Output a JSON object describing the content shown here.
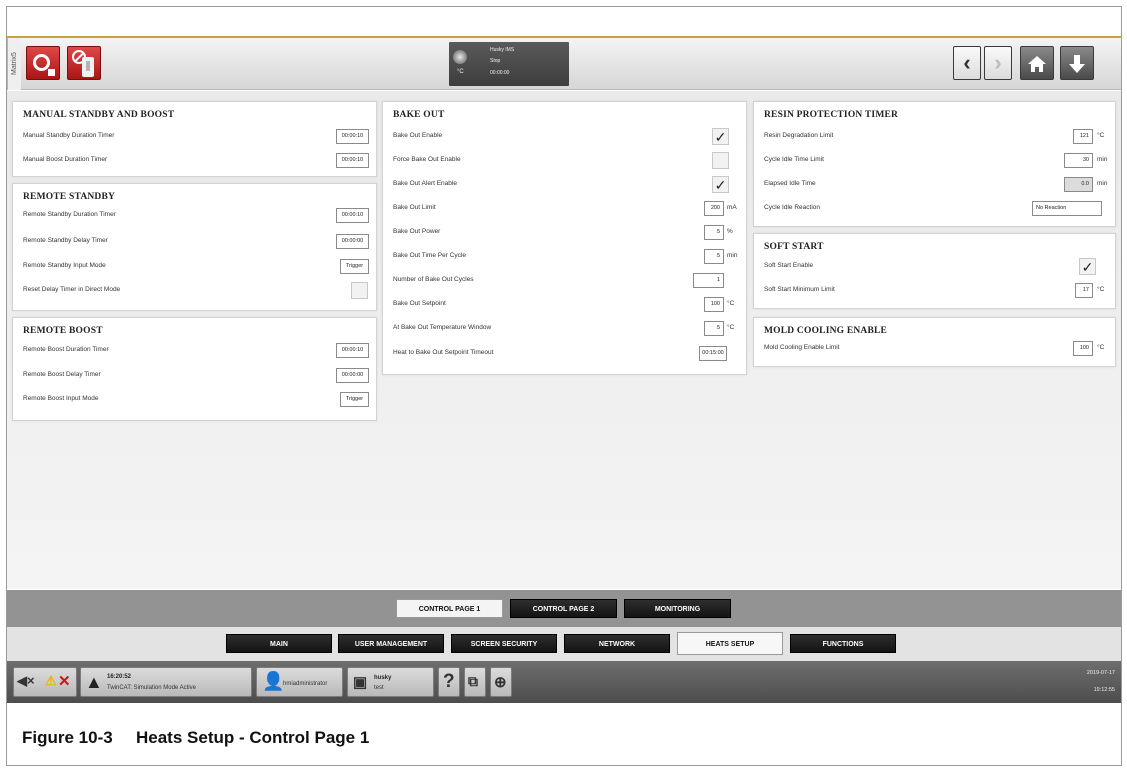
{
  "topbar": {
    "matrix_label": "Matrix5",
    "status": {
      "line1": "Husky IMS",
      "line2": "Stop",
      "line3": "00:00:00",
      "unit": "°C"
    },
    "nav": {
      "back": "‹",
      "forward": "›"
    }
  },
  "manual_standby": {
    "title": "MANUAL STANDBY AND BOOST",
    "rows": [
      {
        "label": "Manual Standby Duration Timer",
        "value": "00:00:10"
      },
      {
        "label": "Manual Boost Duration Timer",
        "value": "00:00:10"
      }
    ]
  },
  "remote_standby": {
    "title": "REMOTE STANDBY",
    "rows": [
      {
        "label": "Remote Standby Duration Timer",
        "value": "00:00:10"
      },
      {
        "label": "Remote Standby Delay Timer",
        "value": "00:00:00"
      },
      {
        "label": "Remote Standby Input Mode",
        "value": "Trigger"
      },
      {
        "label": "Reset Delay Timer in Direct Mode",
        "value": ""
      }
    ]
  },
  "remote_boost": {
    "title": "REMOTE BOOST",
    "rows": [
      {
        "label": "Remote Boost Duration Timer",
        "value": "00:00:10"
      },
      {
        "label": "Remote Boost Delay Timer",
        "value": "00:00:00"
      },
      {
        "label": "Remote Boost Input Mode",
        "value": "Trigger"
      }
    ]
  },
  "bake_out": {
    "title": "BAKE OUT",
    "rows": [
      {
        "label": "Bake Out Enable",
        "checked": true
      },
      {
        "label": "Force Bake Out Enable",
        "checked": false
      },
      {
        "label": "Bake Out Alert Enable",
        "checked": true
      },
      {
        "label": "Bake Out Limit",
        "value": "200",
        "unit": "mA"
      },
      {
        "label": "Bake Out Power",
        "value": "5",
        "unit": "%"
      },
      {
        "label": "Bake Out Time Per Cycle",
        "value": "5",
        "unit": "min"
      },
      {
        "label": "Number of Bake Out Cycles",
        "value": "1"
      },
      {
        "label": "Bake Out Setpoint",
        "value": "100",
        "unit": "°C"
      },
      {
        "label": "At Bake Out Temperature Window",
        "value": "5",
        "unit": "°C"
      },
      {
        "label": "Heat to Bake Out Setpoint Timeout",
        "value": "00:15:00"
      }
    ]
  },
  "resin_protection": {
    "title": "RESIN PROTECTION TIMER",
    "rows": [
      {
        "label": "Resin Degradation Limit",
        "value": "121",
        "unit": "°C"
      },
      {
        "label": "Cycle Idle Time Limit",
        "value": "30",
        "unit": "min"
      },
      {
        "label": "Elapsed Idle Time",
        "value": "0.0",
        "unit": "min"
      },
      {
        "label": "Cycle Idle Reaction",
        "value": "No Reaction"
      }
    ]
  },
  "soft_start": {
    "title": "SOFT START",
    "rows": [
      {
        "label": "Soft Start Enable",
        "checked": true
      },
      {
        "label": "Soft Start Minimum Limit",
        "value": "17",
        "unit": "°C"
      }
    ]
  },
  "mold_cooling": {
    "title": "MOLD COOLING ENABLE",
    "rows": [
      {
        "label": "Mold Cooling Enable Limit",
        "value": "100",
        "unit": "°C"
      }
    ]
  },
  "subtabs": [
    "CONTROL PAGE 1",
    "CONTROL PAGE 2",
    "MONITORING"
  ],
  "maintabs": [
    "MAIN",
    "USER MANAGEMENT",
    "SCREEN SECURITY",
    "NETWORK",
    "HEATS SETUP",
    "FUNCTIONS"
  ],
  "bottombar": {
    "alarm_time": "16:20:52",
    "alarm_text": "TwinCAT: Simulation Mode Active",
    "user": "hmiadministrator",
    "machine_name": "husky",
    "machine_sub": "test",
    "help": "?",
    "date": "2019-07-17",
    "time": "19:12:55"
  },
  "caption": {
    "number": "Figure 10-3",
    "title": "Heats Setup - Control Page 1"
  }
}
